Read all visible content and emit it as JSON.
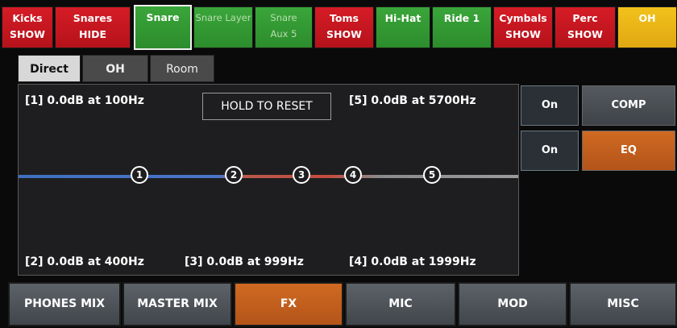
{
  "channels": [
    {
      "name": "Kicks",
      "sub": "SHOW"
    },
    {
      "name": "Snares",
      "sub": "HIDE"
    },
    {
      "name": "Snare",
      "sub": ""
    },
    {
      "name": "Snare Layer",
      "sub": ""
    },
    {
      "name": "Snare",
      "sub": "Aux 5"
    },
    {
      "name": "Toms",
      "sub": "SHOW"
    },
    {
      "name": "Hi-Hat",
      "sub": ""
    },
    {
      "name": "Ride 1",
      "sub": ""
    },
    {
      "name": "Cymbals",
      "sub": "SHOW"
    },
    {
      "name": "Perc",
      "sub": "SHOW"
    },
    {
      "name": "OH",
      "sub": ""
    }
  ],
  "subtabs": [
    "Direct",
    "OH",
    "Room"
  ],
  "eq": {
    "reset_label": "HOLD TO RESET",
    "bands": [
      {
        "label": "[1] 0.0dB at 100Hz",
        "num": "1"
      },
      {
        "label": "[2] 0.0dB at 400Hz",
        "num": "2"
      },
      {
        "label": "[3] 0.0dB at 999Hz",
        "num": "3"
      },
      {
        "label": "[4] 0.0dB at 1999Hz",
        "num": "4"
      },
      {
        "label": "[5] 0.0dB at 5700Hz",
        "num": "5"
      }
    ]
  },
  "side": {
    "comp_on": "On",
    "comp_label": "COMP",
    "eq_on": "On",
    "eq_label": "EQ"
  },
  "bottom_menu": [
    "PHONES MIX",
    "MASTER MIX",
    "FX",
    "MIC",
    "MOD",
    "MISC"
  ],
  "colors": {
    "red": "#c8161f",
    "green": "#33a033",
    "yellow": "#f0b818",
    "orange": "#c85f1e"
  }
}
